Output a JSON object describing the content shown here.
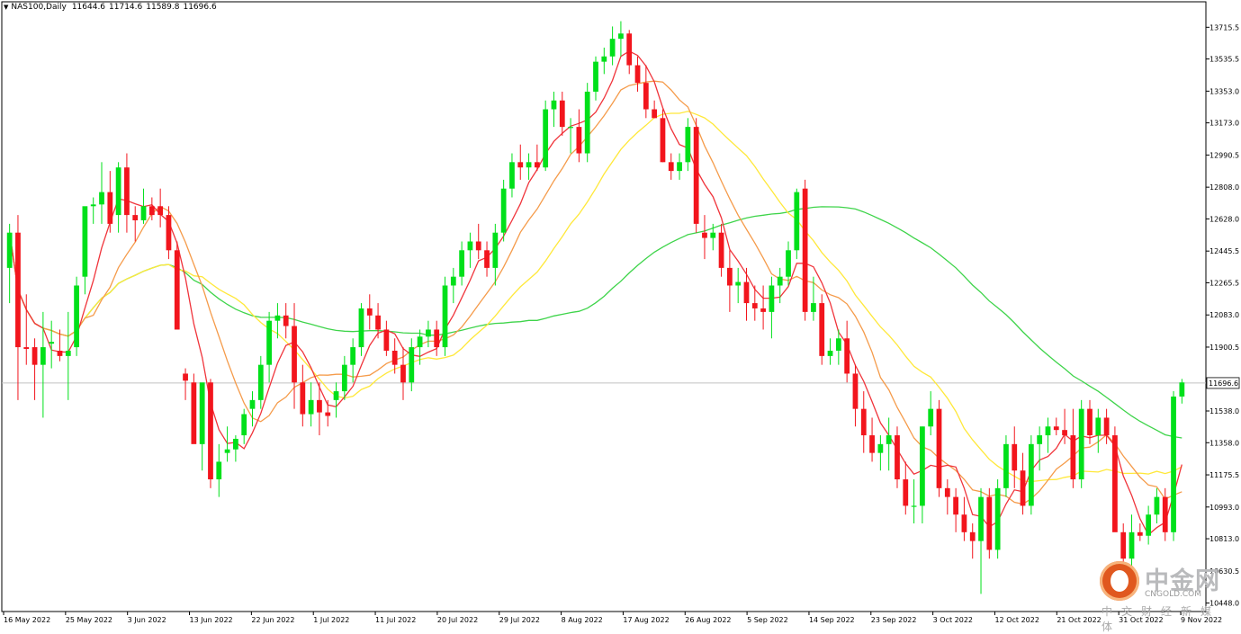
{
  "header": {
    "symbol": "NAS100,Daily",
    "open": "11644.6",
    "high": "11714.6",
    "low": "11589.8",
    "close": "11696.6"
  },
  "colors": {
    "bull": "#00e01a",
    "bear": "#f2151d",
    "ma_fast": "#f0343b",
    "ma_mid": "#f59b4a",
    "ma_slow": "#ffe83a",
    "ma_long": "#3ed44a",
    "axis": "#000000",
    "current_price_line": "#c0c0c0"
  },
  "watermark": {
    "brand": "中金网",
    "domain": "CNGOLD.COM",
    "tagline": "中文财经新媒体",
    "logo": "cngold-logo-icon"
  },
  "chart_data": {
    "type": "candlestick",
    "title": "NAS100,Daily",
    "y_ticks": [
      "13715.5",
      "13535.5",
      "13353.0",
      "13173.0",
      "12990.5",
      "12808.0",
      "12628.0",
      "12445.5",
      "12265.5",
      "12083.0",
      "11900.5",
      "11538.0",
      "11358.0",
      "11175.5",
      "10993.0",
      "10813.0",
      "10630.5",
      "10448.0"
    ],
    "x_labels": [
      "16 May 2022",
      "25 May 2022",
      "3 Jun 2022",
      "13 Jun 2022",
      "22 Jun 2022",
      "1 Jul 2022",
      "11 Jul 2022",
      "20 Jul 2022",
      "29 Jul 2022",
      "8 Aug 2022",
      "17 Aug 2022",
      "26 Aug 2022",
      "5 Sep 2022",
      "14 Sep 2022",
      "23 Sep 2022",
      "3 Oct 2022",
      "12 Oct 2022",
      "21 Oct 2022",
      "31 Oct 2022",
      "9 Nov 2022"
    ],
    "ylim": [
      10400,
      13860
    ],
    "current_price": 11696.6,
    "current_price_label": "11696.6",
    "candles": [
      [
        12350,
        12600,
        12150,
        12550
      ],
      [
        12550,
        12650,
        11600,
        11900
      ],
      [
        11900,
        12200,
        11800,
        11890
      ],
      [
        11900,
        11950,
        11600,
        11800
      ],
      [
        11800,
        12100,
        11500,
        11900
      ],
      [
        11920,
        12050,
        11780,
        11930
      ],
      [
        11880,
        12000,
        11820,
        11850
      ],
      [
        11850,
        12100,
        11600,
        11880
      ],
      [
        11900,
        12300,
        11850,
        12250
      ],
      [
        12300,
        12550,
        12200,
        12700
      ],
      [
        12700,
        12750,
        12600,
        12710
      ],
      [
        12710,
        12950,
        12600,
        12780
      ],
      [
        12780,
        12900,
        12550,
        12600
      ],
      [
        12650,
        12950,
        12550,
        12920
      ],
      [
        12920,
        13000,
        12550,
        12650
      ],
      [
        12650,
        12700,
        12500,
        12620
      ],
      [
        12620,
        12800,
        12600,
        12700
      ],
      [
        12700,
        12750,
        12620,
        12650
      ],
      [
        12700,
        12800,
        12580,
        12650
      ],
      [
        12650,
        12700,
        12400,
        12450
      ],
      [
        12450,
        12500,
        12050,
        12000
      ],
      [
        11750,
        11780,
        11600,
        11710
      ],
      [
        11700,
        11750,
        11400,
        11350
      ],
      [
        11350,
        11650,
        11200,
        11700
      ],
      [
        11700,
        11720,
        11100,
        11150
      ],
      [
        11150,
        11350,
        11050,
        11250
      ],
      [
        11300,
        11450,
        11250,
        11320
      ],
      [
        11320,
        11400,
        11250,
        11380
      ],
      [
        11400,
        11550,
        11350,
        11520
      ],
      [
        11550,
        11650,
        11450,
        11600
      ],
      [
        11600,
        11850,
        11550,
        11800
      ],
      [
        11800,
        12100,
        11700,
        12050
      ],
      [
        12050,
        12150,
        11950,
        12080
      ],
      [
        12080,
        12150,
        11950,
        12020
      ],
      [
        12020,
        12150,
        11550,
        11700
      ],
      [
        11700,
        11800,
        11450,
        11520
      ],
      [
        11520,
        11700,
        11450,
        11600
      ],
      [
        11600,
        11700,
        11400,
        11530
      ],
      [
        11530,
        11600,
        11450,
        11510
      ],
      [
        11600,
        11700,
        11500,
        11650
      ],
      [
        11650,
        11850,
        11600,
        11800
      ],
      [
        11800,
        11950,
        11700,
        11900
      ],
      [
        11900,
        12150,
        11850,
        12120
      ],
      [
        12120,
        12200,
        12000,
        12080
      ],
      [
        12080,
        12150,
        11950,
        12000
      ],
      [
        12000,
        12050,
        11850,
        11880
      ],
      [
        11880,
        11950,
        11750,
        11800
      ],
      [
        11800,
        11900,
        11600,
        11700
      ],
      [
        11700,
        11950,
        11650,
        11900
      ],
      [
        11900,
        12000,
        11800,
        11960
      ],
      [
        11960,
        12050,
        11900,
        12000
      ],
      [
        12000,
        12050,
        11850,
        11900
      ],
      [
        11900,
        12300,
        11850,
        12250
      ],
      [
        12250,
        12350,
        12150,
        12300
      ],
      [
        12300,
        12500,
        12250,
        12450
      ],
      [
        12450,
        12550,
        12350,
        12500
      ],
      [
        12500,
        12600,
        12400,
        12450
      ],
      [
        12450,
        12500,
        12300,
        12350
      ],
      [
        12350,
        12600,
        12250,
        12550
      ],
      [
        12550,
        12850,
        12500,
        12800
      ],
      [
        12800,
        13000,
        12750,
        12950
      ],
      [
        12950,
        13050,
        12850,
        12920
      ],
      [
        12920,
        13000,
        12850,
        12950
      ],
      [
        12950,
        13050,
        12900,
        12920
      ],
      [
        12920,
        13300,
        12900,
        13250
      ],
      [
        13250,
        13350,
        13150,
        13300
      ],
      [
        13300,
        13350,
        13100,
        13150
      ],
      [
        13150,
        13200,
        13000,
        13150
      ],
      [
        13150,
        13250,
        12950,
        13000
      ],
      [
        13000,
        13400,
        12950,
        13350
      ],
      [
        13350,
        13550,
        13300,
        13520
      ],
      [
        13520,
        13600,
        13450,
        13550
      ],
      [
        13550,
        13720,
        13500,
        13650
      ],
      [
        13650,
        13750,
        13550,
        13680
      ],
      [
        13680,
        13700,
        13450,
        13500
      ],
      [
        13500,
        13550,
        13350,
        13400
      ],
      [
        13400,
        13500,
        13200,
        13250
      ],
      [
        13250,
        13300,
        13200,
        13200
      ],
      [
        13200,
        13250,
        12950,
        12950
      ],
      [
        12950,
        13000,
        12850,
        12900
      ],
      [
        12900,
        13000,
        12850,
        12950
      ],
      [
        12950,
        13200,
        12900,
        13150
      ],
      [
        13150,
        13200,
        12550,
        12600
      ],
      [
        12550,
        12650,
        12400,
        12520
      ],
      [
        12520,
        12600,
        12450,
        12550
      ],
      [
        12550,
        12600,
        12300,
        12350
      ],
      [
        12350,
        12450,
        12100,
        12250
      ],
      [
        12250,
        12350,
        12150,
        12270
      ],
      [
        12270,
        12350,
        12050,
        12150
      ],
      [
        12150,
        12250,
        12050,
        12120
      ],
      [
        12120,
        12250,
        12000,
        12100
      ],
      [
        12100,
        12300,
        11950,
        12250
      ],
      [
        12250,
        12350,
        12150,
        12300
      ],
      [
        12300,
        12500,
        12250,
        12450
      ],
      [
        12450,
        12800,
        12400,
        12780
      ],
      [
        12800,
        12850,
        12050,
        12100
      ],
      [
        12100,
        12300,
        12050,
        12150
      ],
      [
        12150,
        12200,
        11800,
        11850
      ],
      [
        11850,
        11950,
        11800,
        11880
      ],
      [
        11880,
        12000,
        11800,
        11950
      ],
      [
        11950,
        12050,
        11700,
        11750
      ],
      [
        11750,
        11800,
        11450,
        11550
      ],
      [
        11550,
        11650,
        11300,
        11400
      ],
      [
        11400,
        11500,
        11250,
        11300
      ],
      [
        11300,
        11400,
        11200,
        11350
      ],
      [
        11350,
        11500,
        11200,
        11400
      ],
      [
        11400,
        11450,
        11100,
        11150
      ],
      [
        11150,
        11250,
        10950,
        11000
      ],
      [
        11000,
        11150,
        10900,
        11000
      ],
      [
        11000,
        11450,
        10900,
        11450
      ],
      [
        11450,
        11650,
        11400,
        11550
      ],
      [
        11550,
        11600,
        11050,
        11100
      ],
      [
        11100,
        11150,
        10950,
        11050
      ],
      [
        11050,
        11100,
        10850,
        10950
      ],
      [
        10950,
        11050,
        10800,
        10850
      ],
      [
        10850,
        10900,
        10700,
        10800
      ],
      [
        10800,
        11100,
        10500,
        11050
      ],
      [
        11050,
        11100,
        10700,
        10750
      ],
      [
        10750,
        11150,
        10700,
        11100
      ],
      [
        11100,
        11400,
        11050,
        11350
      ],
      [
        11350,
        11450,
        11100,
        11200
      ],
      [
        11200,
        11300,
        10950,
        11000
      ],
      [
        11000,
        11400,
        10950,
        11350
      ],
      [
        11350,
        11450,
        11200,
        11400
      ],
      [
        11400,
        11500,
        11300,
        11450
      ],
      [
        11450,
        11500,
        11400,
        11430
      ],
      [
        11430,
        11550,
        11350,
        11400
      ],
      [
        11400,
        11550,
        11100,
        11150
      ],
      [
        11150,
        11600,
        11100,
        11550
      ],
      [
        11550,
        11600,
        11350,
        11400
      ],
      [
        11400,
        11550,
        11300,
        11500
      ],
      [
        11500,
        11550,
        11350,
        11400
      ],
      [
        11400,
        11450,
        10950,
        10850
      ],
      [
        10850,
        10900,
        10650,
        10700
      ],
      [
        10700,
        10950,
        10650,
        10850
      ],
      [
        10850,
        10900,
        10800,
        10830
      ],
      [
        10830,
        11000,
        10780,
        10950
      ],
      [
        10950,
        11100,
        10900,
        11050
      ],
      [
        11050,
        11100,
        10800,
        10850
      ],
      [
        10850,
        11650,
        10800,
        11620
      ],
      [
        11620,
        11720,
        11580,
        11700
      ]
    ]
  }
}
